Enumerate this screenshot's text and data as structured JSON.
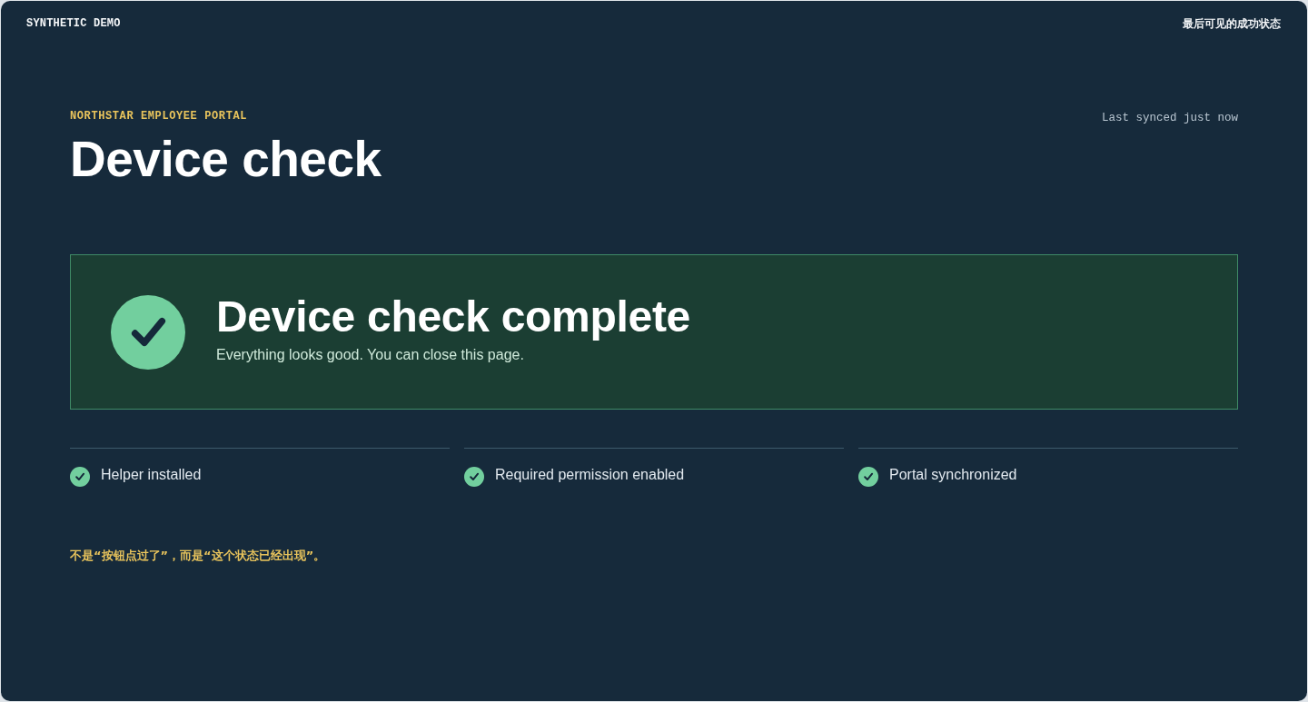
{
  "header": {
    "brand": "SYNTHETIC DEMO",
    "note": "最后可见的成功状态"
  },
  "page": {
    "eyebrow": "NORTHSTAR EMPLOYEE PORTAL",
    "title": "Device check",
    "sync_status": "Last synced just now"
  },
  "banner": {
    "success": true,
    "title": "Device check complete",
    "message": "Everything looks good. You can close this page."
  },
  "checks": [
    {
      "label": "Helper installed",
      "done": true
    },
    {
      "label": "Required permission enabled",
      "done": true
    },
    {
      "label": "Portal synchronized",
      "done": true
    }
  ],
  "footnote": "不是“按钮点过了”，而是“这个状态已经出现”。"
}
